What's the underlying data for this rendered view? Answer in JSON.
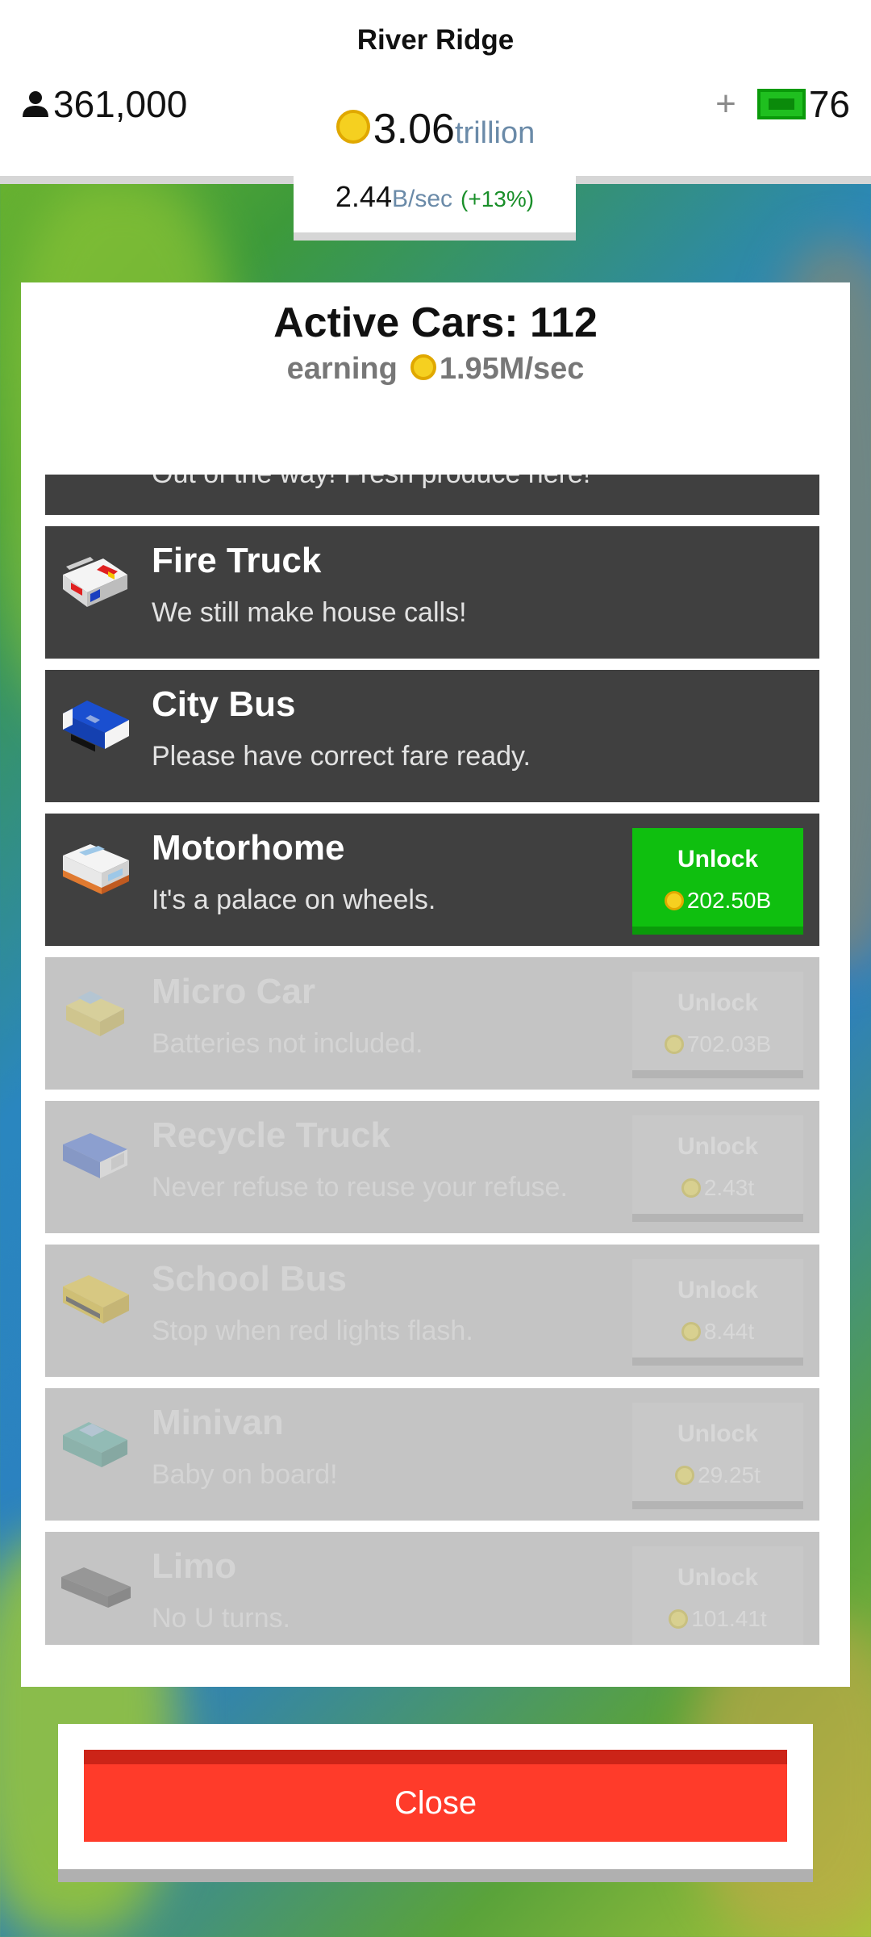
{
  "header": {
    "city_name": "River Ridge",
    "population": "361,000",
    "money_value": "3.06",
    "money_unit": "trillion",
    "cash_plus": "+",
    "cash_value": "76",
    "rate_value": "2.44",
    "rate_unit": "B/sec",
    "rate_change": "(+13%)"
  },
  "panel": {
    "title": "Active Cars: 112",
    "earning_label": "earning",
    "earning_value": "1.95M/sec",
    "partial_row_text": "Out of the way! Fresh produce here!",
    "vehicles": [
      {
        "name": "Fire Truck",
        "desc": "We still make house calls!"
      },
      {
        "name": "City Bus",
        "desc": "Please have correct fare ready."
      },
      {
        "name": "Motorhome",
        "desc": "It's a palace on wheels.",
        "unlock_label": "Unlock",
        "price": "202.50B"
      },
      {
        "name": "Micro Car",
        "desc": "Batteries not included.",
        "unlock_label": "Unlock",
        "price": "702.03B"
      },
      {
        "name": "Recycle Truck",
        "desc": "Never refuse to reuse your refuse.",
        "unlock_label": "Unlock",
        "price": "2.43t"
      },
      {
        "name": "School Bus",
        "desc": "Stop when red lights flash.",
        "unlock_label": "Unlock",
        "price": "8.44t"
      },
      {
        "name": "Minivan",
        "desc": "Baby on board!",
        "unlock_label": "Unlock",
        "price": "29.25t"
      },
      {
        "name": "Limo",
        "desc": "No U turns.",
        "unlock_label": "Unlock",
        "price": "101.41t"
      }
    ]
  },
  "footer": {
    "close_label": "Close"
  },
  "colors": {
    "unlock_green": "#0fbf0f",
    "close_red": "#ff3b2a",
    "row_dark": "#404040",
    "row_locked": "#c4c4c4"
  }
}
